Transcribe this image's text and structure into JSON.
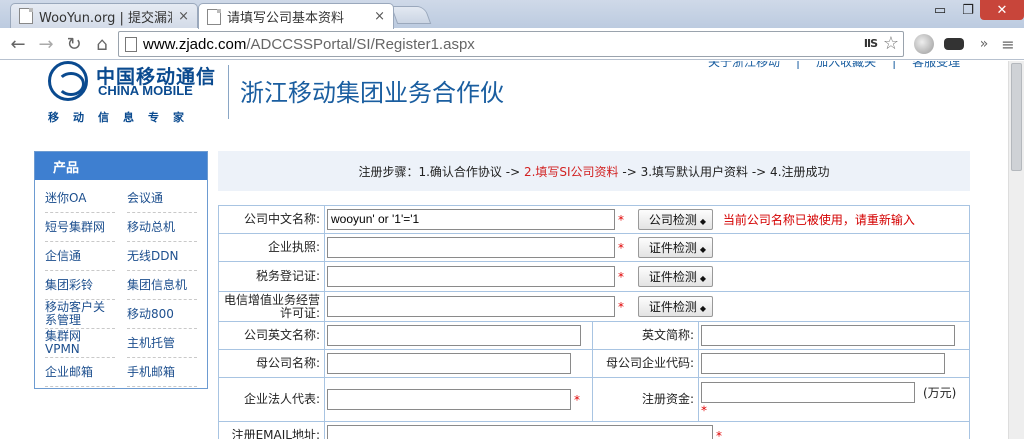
{
  "browser": {
    "tabs": [
      {
        "label": "WooYun.org | 提交漏洞",
        "close": "×"
      },
      {
        "label": "请填写公司基本资料",
        "close": "×"
      }
    ],
    "window": {
      "minimize": "▭",
      "restore": "❐",
      "close": "✕"
    },
    "url_host": "www.zjadc.com",
    "url_path": "/ADCCSSPortal/SI/Register1.aspx",
    "ext_label": "IIS",
    "menu_label": "»",
    "icons": {
      "back": "←",
      "forward": "→",
      "reload": "↻",
      "home": "⌂",
      "star": "☆"
    }
  },
  "header": {
    "logo_cn": "中国移动通信",
    "logo_en": "CHINA MOBILE",
    "logo_sub": "移动信息专家",
    "title": "浙江移动集团业务合作伙",
    "links": [
      "关于浙江移动",
      "|",
      "加入收藏夹",
      "|",
      "客服受理"
    ]
  },
  "sidebar": {
    "title": "产品",
    "items": [
      "迷你OA",
      "会议通",
      "短号集群网",
      "移动总机",
      "企信通",
      "无线DDN",
      "集团彩铃",
      "集团信息机",
      "移动客户关系管理",
      "移动800",
      "集群网VPMN",
      "主机托管",
      "企业邮箱",
      "手机邮箱"
    ]
  },
  "steps": {
    "prefix": "注册步骤：1.确认合作协议 ->",
    "current": "2.填写SI公司资料",
    "suffix": "-> 3.填写默认用户资料 -> 4.注册成功"
  },
  "form": {
    "required_mark": "*",
    "company_name": {
      "label": "公司中文名称:",
      "value": "wooyun' or '1'='1",
      "button": "公司检测",
      "error": "当前公司名称已被使用，请重新输入"
    },
    "business_license": {
      "label": "企业执照:",
      "value": "",
      "button": "证件检测"
    },
    "tax_cert": {
      "label": "税务登记证:",
      "value": "",
      "button": "证件检测"
    },
    "telecom_license": {
      "label": "电信增值业务经营许可证:",
      "value": "",
      "button": "证件检测"
    },
    "company_en_name": {
      "label": "公司英文名称:",
      "value": ""
    },
    "en_abbrev": {
      "label": "英文简称:",
      "value": ""
    },
    "parent_name": {
      "label": "母公司名称:",
      "value": ""
    },
    "parent_code": {
      "label": "母公司企业代码:",
      "value": ""
    },
    "legal_rep": {
      "label": "企业法人代表:",
      "value": ""
    },
    "reg_capital": {
      "label": "注册资金:",
      "value": "",
      "unit": "(万元)"
    },
    "email": {
      "label": "注册EMAIL地址:",
      "value": ""
    }
  }
}
